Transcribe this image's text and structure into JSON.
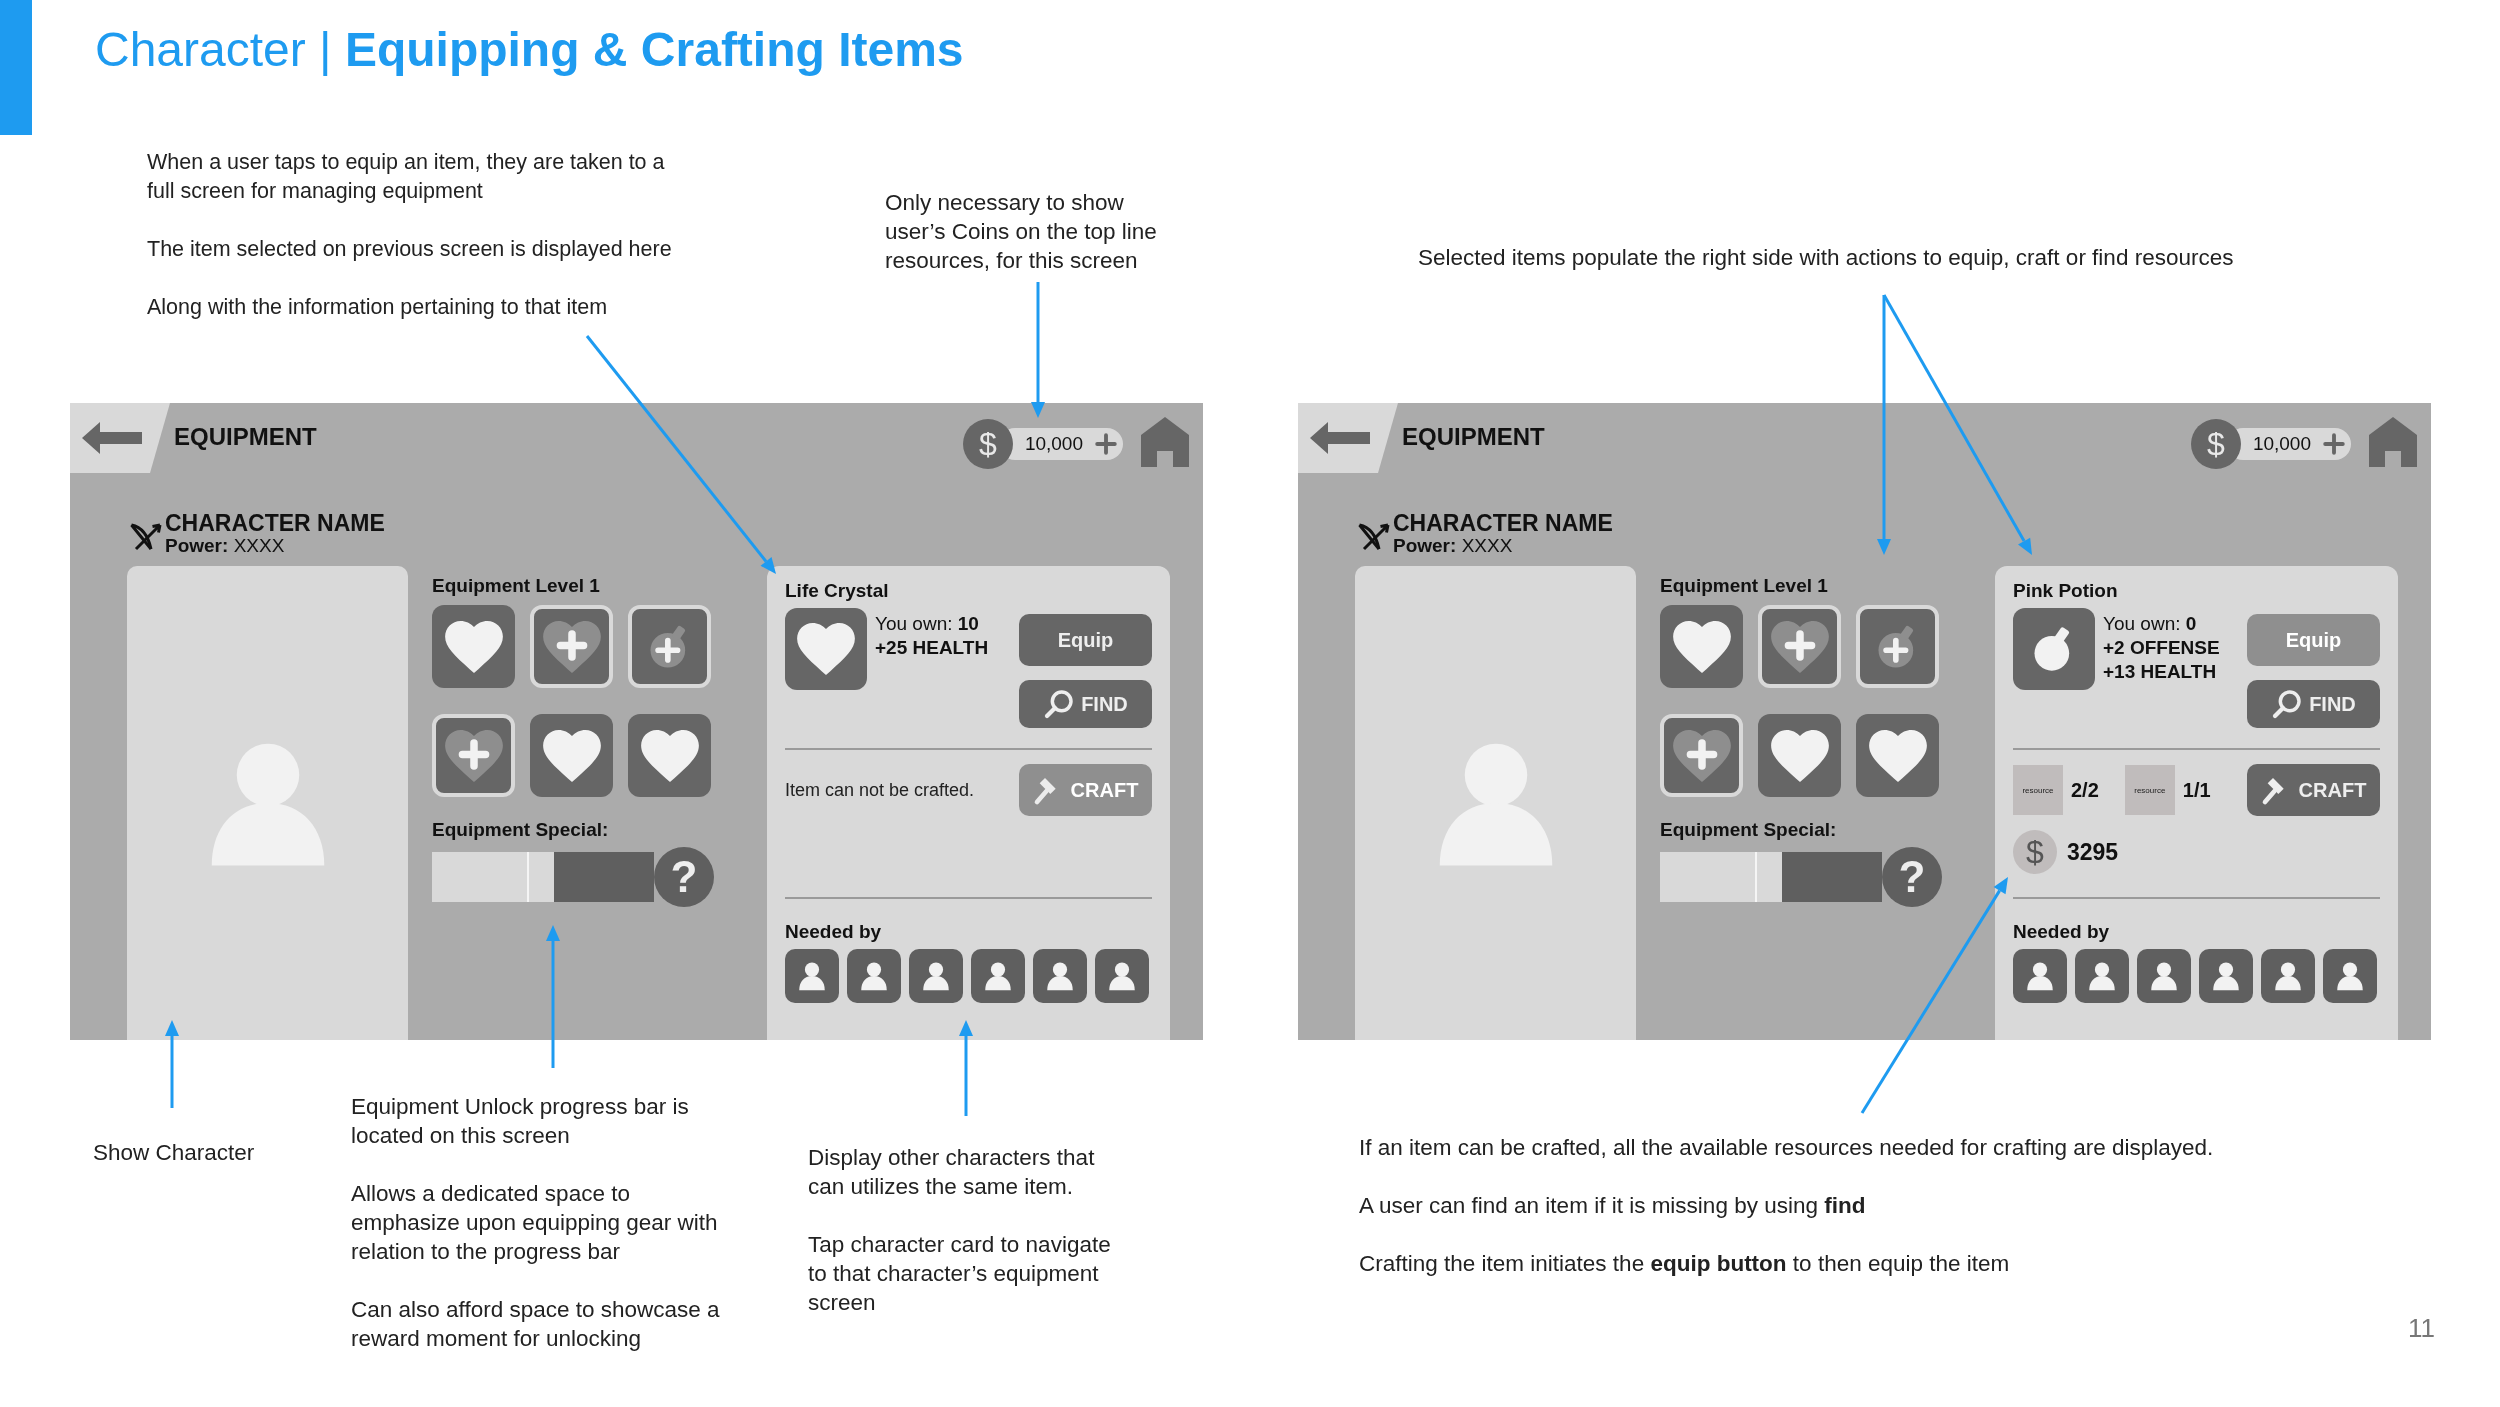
{
  "title": "Character | **Equipping & Crafting Items**",
  "notes_top_left": [
    "When a user taps to equip an item, they are taken to a full screen for managing equipment",
    "The item selected on previous screen is displayed here",
    "Along with the information pertaining to that item"
  ],
  "notes_top_middle": [
    "Only necessary to show user’s Coins on the top line resources, for this screen"
  ],
  "notes_top_right": [
    "Selected items populate the right side with actions to equip, craft or find resources"
  ],
  "screens": [
    {
      "header": {
        "title": "EQUIPMENT",
        "currency": "$",
        "coins": "10,000"
      },
      "character": {
        "name": "CHARACTER NAME",
        "power": "**Power:** XXXX"
      },
      "equipment_level": {
        "label": "Equipment Level 1",
        "slots": [
          {
            "kind": "heart"
          },
          {
            "kind": "heart-plus"
          },
          {
            "kind": "potion-plus"
          },
          {
            "kind": "heart-plus"
          },
          {
            "kind": "heart"
          },
          {
            "kind": "heart"
          }
        ]
      },
      "special": {
        "label": "Equipment Special:",
        "level": 0.55,
        "help": "?"
      },
      "item": {
        "name": "Life Crystal",
        "kind": "heart",
        "owned": "You own: **10**",
        "stats": [
          "+25 HEALTH"
        ],
        "equip": {
          "label": "Equip",
          "disabled": false
        },
        "find": {
          "label": "FIND"
        },
        "craft": {
          "label": "CRAFT",
          "disabled": true
        },
        "craft_note": "Item can not be crafted.",
        "needed_by": {
          "label": "Needed by",
          "characters": [
            {
              "kind": "character"
            },
            {
              "kind": "character"
            },
            {
              "kind": "character"
            },
            {
              "kind": "character"
            },
            {
              "kind": "character"
            },
            {
              "kind": "character"
            }
          ]
        }
      }
    },
    {
      "header": {
        "title": "EQUIPMENT",
        "currency": "$",
        "coins": "10,000"
      },
      "character": {
        "name": "CHARACTER NAME",
        "power": "**Power:** XXXX"
      },
      "equipment_level": {
        "label": "Equipment Level 1",
        "slots": [
          {
            "kind": "heart"
          },
          {
            "kind": "heart-plus"
          },
          {
            "kind": "potion-plus"
          },
          {
            "kind": "heart-plus"
          },
          {
            "kind": "heart"
          },
          {
            "kind": "heart"
          }
        ]
      },
      "special": {
        "label": "Equipment Special:",
        "level": 0.55,
        "help": "?"
      },
      "item": {
        "name": "Pink Potion",
        "kind": "potion",
        "owned": "You own: **0**",
        "stats": [
          "+2 OFFENSE",
          "+13 HEALTH"
        ],
        "equip": {
          "label": "Equip",
          "disabled": true
        },
        "find": {
          "label": "FIND"
        },
        "craft": {
          "label": "CRAFT",
          "disabled": false
        },
        "resources": [
          {
            "label": "resource",
            "amount": "2/2"
          },
          {
            "label": "resource",
            "amount": "1/1"
          }
        ],
        "cost": {
          "currency": "$",
          "amount": "3295"
        },
        "needed_by": {
          "label": "Needed by",
          "characters": [
            {
              "kind": "character"
            },
            {
              "kind": "character"
            },
            {
              "kind": "character"
            },
            {
              "kind": "character"
            },
            {
              "kind": "character"
            },
            {
              "kind": "character"
            }
          ]
        }
      }
    }
  ],
  "notes_bottom_left": [
    "Show Character"
  ],
  "notes_bottom_middle": [
    "Equipment Unlock progress bar is located on this screen",
    "Allows a dedicated space to emphasize upon equipping gear with relation to the progress bar",
    "Can also afford space to showcase a reward moment for unlocking"
  ],
  "notes_bottom_center": [
    "Display other characters that can utilizes the same item.",
    "Tap character card to navigate to that character’s equipment screen"
  ],
  "notes_bottom_right": [
    "If an item can be crafted, all the available resources needed for crafting are displayed.",
    "A user can find an item if it is missing by using **find**",
    "Crafting the item initiates the **equip button** to then equip the item"
  ],
  "page_number": "11"
}
